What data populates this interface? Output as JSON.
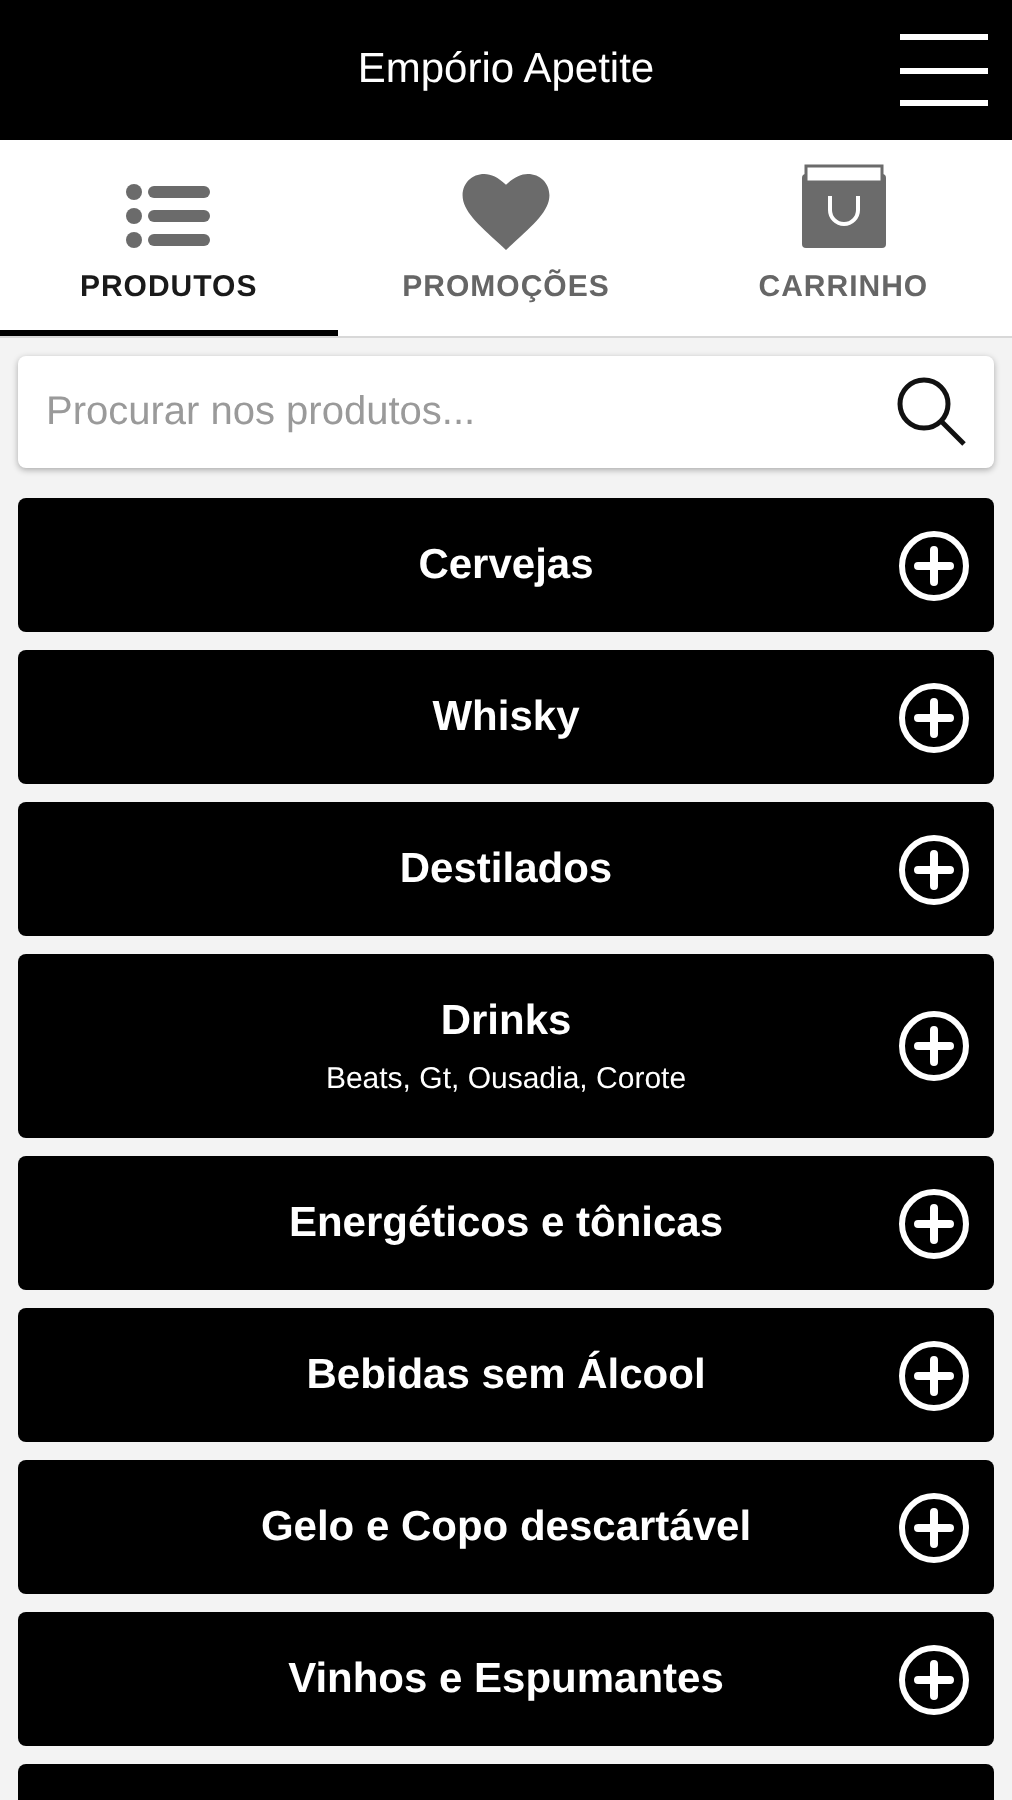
{
  "header": {
    "title": "Empório Apetite"
  },
  "tabs": [
    {
      "label": "PRODUTOS",
      "selected": true
    },
    {
      "label": "PROMOÇÕES",
      "selected": false
    },
    {
      "label": "CARRINHO",
      "selected": false
    }
  ],
  "search": {
    "placeholder": "Procurar nos produtos..."
  },
  "categories": [
    {
      "name": "Cervejas"
    },
    {
      "name": "Whisky"
    },
    {
      "name": "Destilados"
    },
    {
      "name": "Drinks",
      "subtitle": "Beats, Gt, Ousadia, Corote"
    },
    {
      "name": "Energéticos e tônicas"
    },
    {
      "name": "Bebidas sem Álcool"
    },
    {
      "name": "Gelo e Copo descartável"
    },
    {
      "name": "Vinhos e Espumantes"
    }
  ]
}
